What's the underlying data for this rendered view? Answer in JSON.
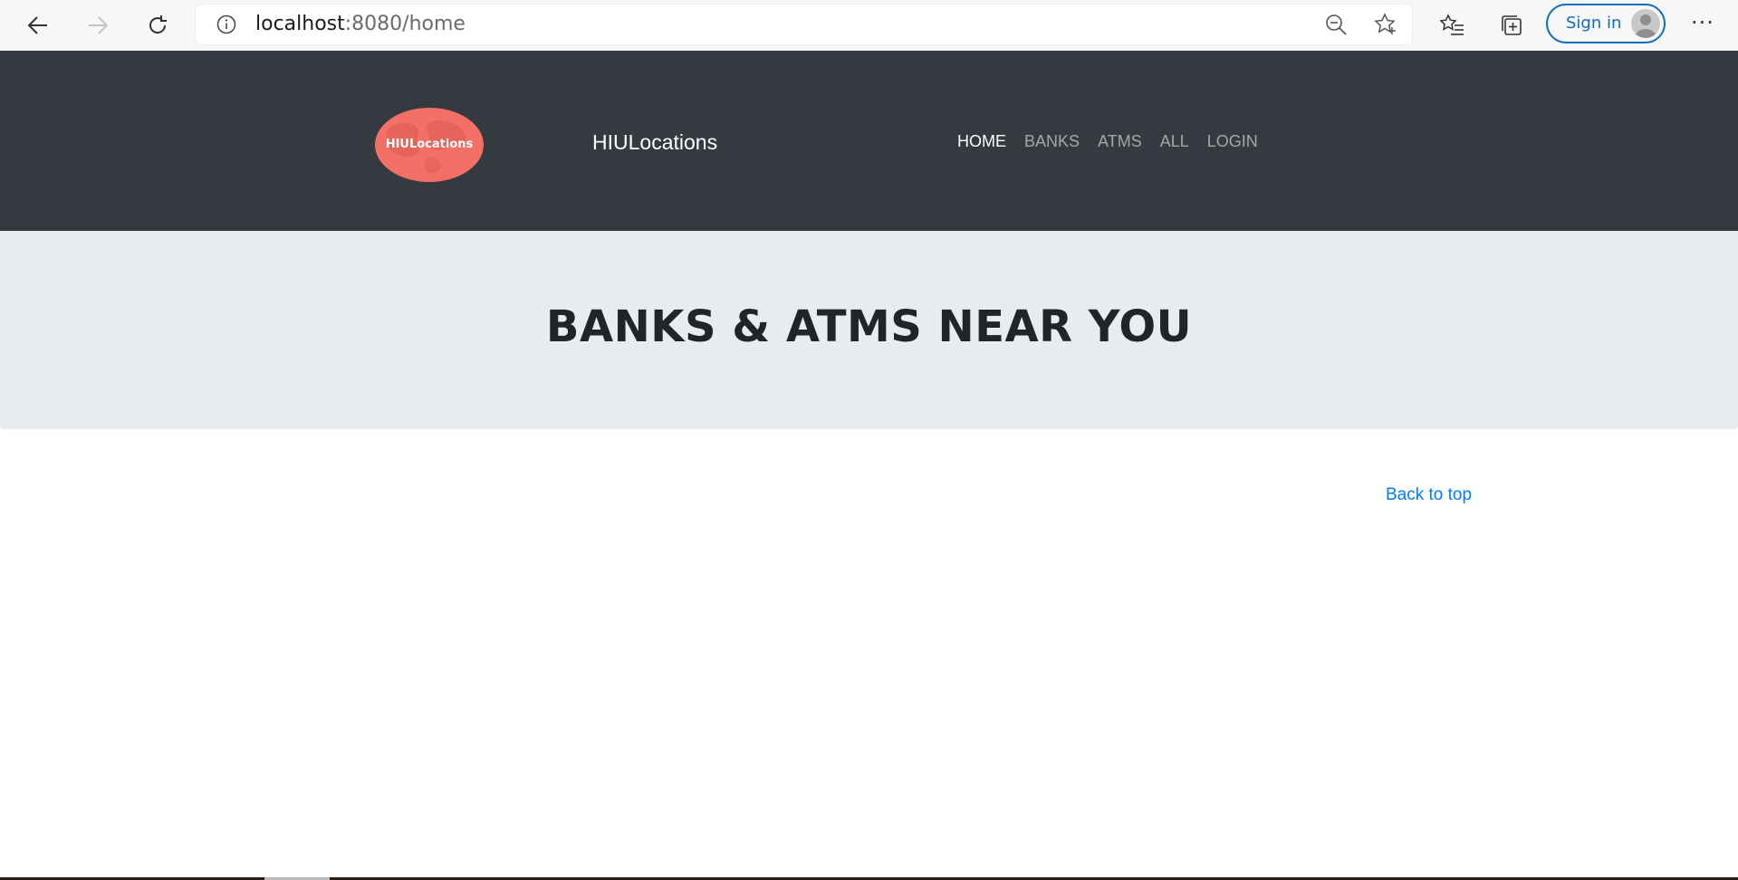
{
  "browser": {
    "url_host": "localhost",
    "url_rest": ":8080/home",
    "signin_label": "Sign in",
    "more_label": "···"
  },
  "header": {
    "logo_text": "HIULocations",
    "brand": "HIULocations",
    "nav": [
      {
        "label": "HOME",
        "active": true
      },
      {
        "label": "BANKS",
        "active": false
      },
      {
        "label": "ATMS",
        "active": false
      },
      {
        "label": "ALL",
        "active": false
      },
      {
        "label": "LOGIN",
        "active": false
      }
    ]
  },
  "main": {
    "title": "BANKS & ATMS NEAR YOU"
  },
  "footer": {
    "back_to_top": "Back to top"
  },
  "colors": {
    "header_bg": "#343a40",
    "jumbotron_bg": "#e9ecef",
    "logo_bg": "#f27066",
    "link": "#007bff",
    "browser_accent": "#0f6cbd"
  }
}
